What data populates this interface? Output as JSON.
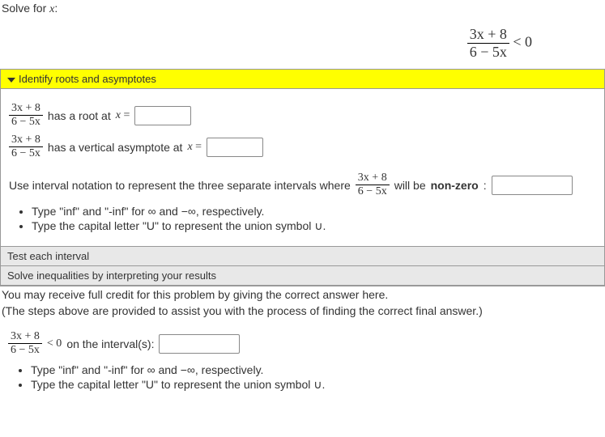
{
  "prompt": {
    "prefix": "Solve for ",
    "var": "x",
    "suffix": ":"
  },
  "expr": {
    "num": "3x + 8",
    "den": "6 − 5x"
  },
  "mainIneq": " < 0",
  "sections": {
    "s1": {
      "title": "Identify roots and asymptotes",
      "rootText1": " has a root at ",
      "rootEq": "x =",
      "asympText1": " has a vertical asymptote at ",
      "asympEq": "x =",
      "intervalText1": "Use interval notation to represent the three separate intervals where ",
      "intervalText2": " will be ",
      "intervalText3": "non-zero",
      "intervalText4": ":",
      "hints": [
        "Type \"inf\" and \"-inf\" for ∞ and −∞, respectively.",
        "Type the capital letter \"U\" to represent the union symbol ∪."
      ]
    },
    "s2": {
      "title": "Test each interval"
    },
    "s3": {
      "title": "Solve inequalities by interpreting your results"
    }
  },
  "final": {
    "note1": "You may receive full credit for this problem by giving the correct answer here.",
    "note2": "(The steps above are provided to assist you with the process of finding the correct final answer.)",
    "ineqText": " < 0 ",
    "onText": "on the interval(s):",
    "hints": [
      "Type \"inf\" and \"-inf\" for ∞ and −∞, respectively.",
      "Type the capital letter \"U\" to represent the union symbol ∪."
    ]
  },
  "inputs": {
    "root": "",
    "asymptote": "",
    "nonzero": "",
    "answer": ""
  }
}
